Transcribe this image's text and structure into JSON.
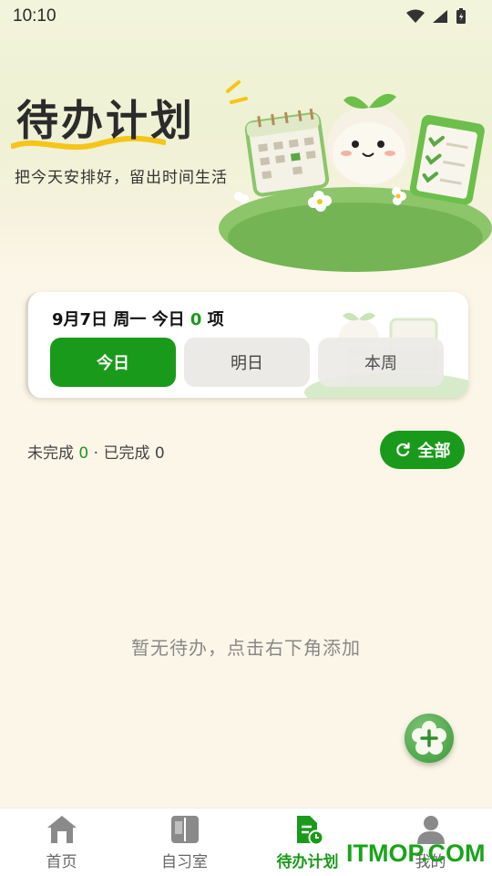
{
  "status_bar": {
    "time": "10:10"
  },
  "hero": {
    "title": "待办计划",
    "subtitle": "把今天安排好，留出时间生活"
  },
  "date_card": {
    "date_prefix": "9月7日 周一 今日 ",
    "count": "0",
    "suffix": " 项",
    "tabs": [
      "今日",
      "明日",
      "本周"
    ],
    "selected_tab": "今日"
  },
  "progress": {
    "incomplete_label": "未完成 ",
    "incomplete_count": "0",
    "separator": " · ",
    "complete_label": "已完成 ",
    "complete_count": "0"
  },
  "filter_button": {
    "label": "全部",
    "icon": "refresh-icon"
  },
  "empty_state": {
    "text": "暂无待办，点击右下角添加"
  },
  "fab": {
    "icon": "add-flower-icon"
  },
  "bottom_nav": {
    "items": [
      {
        "label": "首页",
        "icon": "home-icon"
      },
      {
        "label": "自习室",
        "icon": "book-icon"
      },
      {
        "label": "待办计划",
        "icon": "todo-doc-icon",
        "active": true
      },
      {
        "label": "我的",
        "icon": "user-icon"
      }
    ]
  },
  "watermark": "ITMOP.COM",
  "colors": {
    "accent": "#1a9a1a",
    "background": "#fcf6e8",
    "inactive_tab": "#ebeae7"
  }
}
